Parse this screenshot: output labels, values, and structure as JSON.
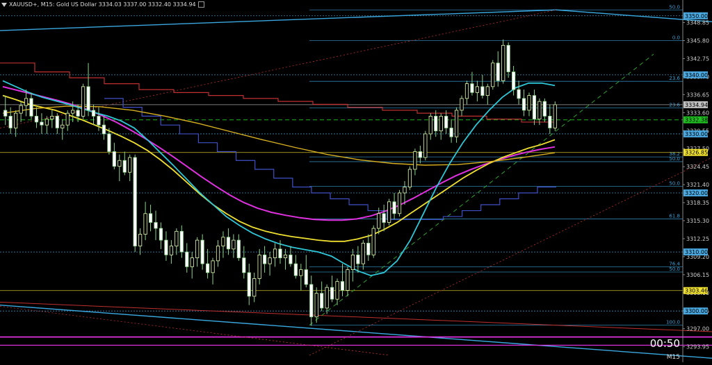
{
  "header": {
    "text": "XAUUSD+, M15: Gold US Dollar 3334.03 3337.00 3332.40 3334.94"
  },
  "footer": {
    "timer": "00:50",
    "timeframe": "M15"
  },
  "colors": {
    "background": "#000000",
    "bull": "#e8ffb0",
    "bear": "#ffffff",
    "ma_cyan": "#2ec8d8",
    "ma_yellow": "#f0e030",
    "ma_magenta": "#e030e0",
    "step_blue": "#4050c8",
    "step_red": "#c03030",
    "fib": "#3aa0d8",
    "grid": "#20406a"
  },
  "chart_data": {
    "type": "candlestick",
    "symbol": "XAUUSD+",
    "timeframe": "M15",
    "ylim": [
      3292.5,
      3351.5
    ],
    "y_ticks": [
      "3348.85",
      "3345.80",
      "3342.75",
      "3339.70",
      "3336.65",
      "3333.60",
      "3330.55",
      "3327.50",
      "3324.45",
      "3321.40",
      "3318.35",
      "3315.30",
      "3312.25",
      "3309.20",
      "3306.15",
      "3303.10",
      "3300.05",
      "3297.00",
      "3293.95"
    ],
    "price_tags": [
      {
        "value": 3350.0,
        "label": "3350.00",
        "color": "#4aa8e0"
      },
      {
        "value": 3340.0,
        "label": "3340.00",
        "color": "#4aa8e0"
      },
      {
        "value": 3334.94,
        "label": "3334.94",
        "color": "#c0c0c0"
      },
      {
        "value": 3332.38,
        "label": "3332.38",
        "color": "#20c020"
      },
      {
        "value": 3330.0,
        "label": "3330.00",
        "color": "#4aa8e0"
      },
      {
        "value": 3326.85,
        "label": "3326.85",
        "color": "#f0e030"
      },
      {
        "value": 3320.0,
        "label": "3320.00",
        "color": "#4aa8e0"
      },
      {
        "value": 3310.0,
        "label": "3310.00",
        "color": "#4aa8e0"
      },
      {
        "value": 3303.46,
        "label": "3303.46",
        "color": "#f0e030"
      },
      {
        "value": 3300.0,
        "label": "3300.00",
        "color": "#4aa8e0"
      }
    ],
    "fib_levels": [
      {
        "label": "0.0",
        "value": 3345.8
      },
      {
        "label": "23.6",
        "value": 3338.9
      },
      {
        "label": "23.6",
        "value": 3334.4
      },
      {
        "label": "38.2",
        "value": 3326.1
      },
      {
        "label": "50.0",
        "value": 3325.3
      },
      {
        "label": "50.0",
        "value": 3321.1
      },
      {
        "label": "61.8",
        "value": 3315.6
      },
      {
        "label": "76.4",
        "value": 3307.5
      },
      {
        "label": "50.0",
        "value": 3306.6
      },
      {
        "label": "100.0",
        "value": 3297.6
      },
      {
        "label": "50.0",
        "value": 3351.0
      }
    ],
    "candles": [
      [
        3334.0,
        3336.5,
        3331.5,
        3333.0
      ],
      [
        3333.0,
        3334.5,
        3330.0,
        3331.0
      ],
      [
        3331.0,
        3334.0,
        3329.5,
        3333.5
      ],
      [
        3333.5,
        3335.5,
        3332.0,
        3334.8
      ],
      [
        3334.8,
        3337.5,
        3333.0,
        3336.0
      ],
      [
        3336.0,
        3337.0,
        3332.5,
        3333.0
      ],
      [
        3333.0,
        3334.5,
        3331.0,
        3332.0
      ],
      [
        3332.0,
        3333.5,
        3330.0,
        3331.5
      ],
      [
        3331.5,
        3333.0,
        3330.0,
        3332.5
      ],
      [
        3332.5,
        3334.0,
        3331.0,
        3333.0
      ],
      [
        3333.0,
        3333.5,
        3330.0,
        3331.0
      ],
      [
        3331.0,
        3332.5,
        3329.0,
        3331.5
      ],
      [
        3331.5,
        3334.0,
        3330.5,
        3333.5
      ],
      [
        3333.5,
        3335.5,
        3332.0,
        3334.0
      ],
      [
        3334.0,
        3335.0,
        3332.0,
        3333.0
      ],
      [
        3333.0,
        3338.5,
        3332.5,
        3338.0
      ],
      [
        3338.0,
        3342.0,
        3333.0,
        3334.0
      ],
      [
        3334.0,
        3335.0,
        3331.5,
        3333.0
      ],
      [
        3333.0,
        3334.5,
        3330.5,
        3331.5
      ],
      [
        3331.5,
        3333.0,
        3329.0,
        3330.0
      ],
      [
        3330.0,
        3331.0,
        3326.5,
        3327.0
      ],
      [
        3327.0,
        3328.5,
        3324.0,
        3324.5
      ],
      [
        3324.5,
        3326.5,
        3322.0,
        3325.5
      ],
      [
        3325.5,
        3327.0,
        3323.0,
        3323.5
      ],
      [
        3323.5,
        3326.5,
        3322.0,
        3326.0
      ],
      [
        3326.0,
        3326.5,
        3310.0,
        3311.0
      ],
      [
        3311.0,
        3314.0,
        3309.5,
        3313.0
      ],
      [
        3313.0,
        3318.5,
        3312.0,
        3316.5
      ],
      [
        3316.5,
        3318.0,
        3313.5,
        3315.0
      ],
      [
        3315.0,
        3317.0,
        3312.0,
        3314.0
      ],
      [
        3314.0,
        3315.0,
        3310.5,
        3312.0
      ],
      [
        3312.0,
        3313.5,
        3308.5,
        3309.5
      ],
      [
        3309.5,
        3312.0,
        3308.0,
        3311.0
      ],
      [
        3311.0,
        3314.0,
        3309.5,
        3313.5
      ],
      [
        3313.5,
        3314.5,
        3309.0,
        3310.0
      ],
      [
        3310.0,
        3311.5,
        3306.5,
        3307.5
      ],
      [
        3307.5,
        3310.0,
        3305.5,
        3309.0
      ],
      [
        3309.0,
        3312.5,
        3307.5,
        3312.0
      ],
      [
        3312.0,
        3313.0,
        3307.0,
        3308.0
      ],
      [
        3308.0,
        3310.5,
        3305.5,
        3306.5
      ],
      [
        3306.5,
        3309.0,
        3304.5,
        3308.5
      ],
      [
        3308.5,
        3312.0,
        3307.5,
        3311.0
      ],
      [
        3311.0,
        3313.5,
        3309.0,
        3312.5
      ],
      [
        3312.5,
        3314.0,
        3309.5,
        3310.5
      ],
      [
        3310.5,
        3313.0,
        3309.0,
        3312.0
      ],
      [
        3312.0,
        3313.0,
        3308.5,
        3309.0
      ],
      [
        3309.0,
        3311.0,
        3305.5,
        3306.5
      ],
      [
        3306.5,
        3308.0,
        3301.0,
        3302.5
      ],
      [
        3302.5,
        3306.5,
        3301.5,
        3305.5
      ],
      [
        3305.5,
        3310.5,
        3304.5,
        3309.5
      ],
      [
        3309.5,
        3311.0,
        3306.5,
        3308.0
      ],
      [
        3308.0,
        3310.0,
        3306.0,
        3309.0
      ],
      [
        3309.0,
        3311.5,
        3307.5,
        3310.5
      ],
      [
        3310.5,
        3312.0,
        3308.0,
        3309.0
      ],
      [
        3309.0,
        3310.5,
        3307.0,
        3309.5
      ],
      [
        3309.5,
        3311.0,
        3307.5,
        3308.0
      ],
      [
        3308.0,
        3309.5,
        3305.5,
        3306.0
      ],
      [
        3306.0,
        3308.0,
        3303.5,
        3307.0
      ],
      [
        3307.0,
        3309.5,
        3304.0,
        3304.5
      ],
      [
        3304.5,
        3306.0,
        3297.5,
        3299.0
      ],
      [
        3299.0,
        3304.0,
        3298.0,
        3303.0
      ],
      [
        3303.0,
        3305.0,
        3300.0,
        3300.5
      ],
      [
        3300.5,
        3304.5,
        3299.5,
        3304.0
      ],
      [
        3304.0,
        3306.0,
        3301.5,
        3302.0
      ],
      [
        3302.0,
        3305.5,
        3301.0,
        3305.0
      ],
      [
        3305.0,
        3308.0,
        3302.5,
        3303.5
      ],
      [
        3303.5,
        3307.5,
        3302.5,
        3307.0
      ],
      [
        3307.0,
        3310.5,
        3305.0,
        3309.5
      ],
      [
        3309.5,
        3311.0,
        3306.5,
        3308.0
      ],
      [
        3308.0,
        3312.0,
        3307.0,
        3311.5
      ],
      [
        3311.5,
        3313.0,
        3308.5,
        3309.5
      ],
      [
        3309.5,
        3314.5,
        3309.0,
        3314.0
      ],
      [
        3314.0,
        3317.5,
        3313.0,
        3316.5
      ],
      [
        3316.5,
        3318.0,
        3313.5,
        3315.0
      ],
      [
        3315.0,
        3319.0,
        3314.5,
        3318.5
      ],
      [
        3318.5,
        3320.0,
        3315.5,
        3316.5
      ],
      [
        3316.5,
        3320.5,
        3316.0,
        3320.0
      ],
      [
        3320.0,
        3322.0,
        3318.0,
        3321.0
      ],
      [
        3321.0,
        3324.5,
        3320.5,
        3324.0
      ],
      [
        3324.0,
        3327.5,
        3323.0,
        3327.0
      ],
      [
        3327.0,
        3328.0,
        3325.0,
        3326.0
      ],
      [
        3326.0,
        3330.5,
        3325.5,
        3330.0
      ],
      [
        3330.0,
        3333.5,
        3329.0,
        3333.0
      ],
      [
        3333.0,
        3334.0,
        3329.5,
        3330.5
      ],
      [
        3330.5,
        3333.5,
        3329.0,
        3333.0
      ],
      [
        3333.0,
        3334.0,
        3330.0,
        3331.0
      ],
      [
        3331.0,
        3332.5,
        3328.5,
        3329.5
      ],
      [
        3329.5,
        3334.5,
        3328.5,
        3334.0
      ],
      [
        3334.0,
        3336.5,
        3333.0,
        3336.0
      ],
      [
        3336.0,
        3339.0,
        3335.0,
        3338.5
      ],
      [
        3338.5,
        3340.5,
        3336.5,
        3337.0
      ],
      [
        3337.0,
        3339.0,
        3335.5,
        3338.0
      ],
      [
        3338.0,
        3340.0,
        3336.0,
        3336.5
      ],
      [
        3336.5,
        3338.5,
        3335.0,
        3338.0
      ],
      [
        3338.0,
        3342.5,
        3337.5,
        3342.0
      ],
      [
        3342.0,
        3344.0,
        3338.0,
        3339.0
      ],
      [
        3339.0,
        3346.0,
        3338.5,
        3345.0
      ],
      [
        3345.0,
        3345.5,
        3339.5,
        3340.5
      ],
      [
        3340.5,
        3341.5,
        3336.5,
        3337.5
      ],
      [
        3337.5,
        3339.0,
        3335.0,
        3336.0
      ],
      [
        3336.0,
        3337.5,
        3333.0,
        3334.0
      ],
      [
        3334.0,
        3337.0,
        3333.0,
        3336.5
      ],
      [
        3336.5,
        3337.5,
        3331.5,
        3332.5
      ],
      [
        3332.5,
        3336.0,
        3331.5,
        3335.5
      ],
      [
        3335.5,
        3336.0,
        3332.0,
        3333.0
      ],
      [
        3333.0,
        3335.0,
        3330.0,
        3331.0
      ],
      [
        3331.0,
        3335.5,
        3330.5,
        3334.94
      ]
    ],
    "ma_cyan": [
      3339.0,
      3338.0,
      3337.0,
      3336.2,
      3335.6,
      3335.0,
      3334.3,
      3333.6,
      3333.0,
      3332.2,
      3331.0,
      3329.0,
      3326.8,
      3324.6,
      3322.3,
      3320.0,
      3318.0,
      3316.0,
      3314.5,
      3313.2,
      3312.2,
      3311.4,
      3310.8,
      3310.4,
      3310.0,
      3309.3,
      3308.0,
      3306.8,
      3306.0,
      3306.5,
      3308.5,
      3312.0,
      3316.5,
      3321.0,
      3325.0,
      3328.5,
      3331.5,
      3334.0,
      3336.2,
      3337.8,
      3338.6,
      3338.6,
      3338.2
    ],
    "ma_yellow": [
      3336.5,
      3335.8,
      3335.0,
      3334.5,
      3334.0,
      3333.2,
      3332.4,
      3331.5,
      3330.6,
      3329.6,
      3328.5,
      3327.2,
      3325.6,
      3323.8,
      3321.8,
      3319.8,
      3318.0,
      3316.5,
      3315.2,
      3314.2,
      3313.5,
      3313.0,
      3312.6,
      3312.3,
      3312.0,
      3311.8,
      3311.8,
      3312.2,
      3312.8,
      3313.8,
      3315.0,
      3316.5,
      3318.0,
      3319.5,
      3321.0,
      3322.5,
      3323.8,
      3325.0,
      3326.0,
      3326.8,
      3327.6,
      3328.2,
      3329.0
    ],
    "ma_magenta": [
      3338.0,
      3337.4,
      3336.8,
      3336.2,
      3335.6,
      3334.9,
      3334.1,
      3333.1,
      3332.0,
      3330.7,
      3329.3,
      3327.8,
      3326.2,
      3324.5,
      3322.8,
      3321.2,
      3319.7,
      3318.4,
      3317.4,
      3316.7,
      3316.2,
      3315.8,
      3315.5,
      3315.4,
      3315.4,
      3315.6,
      3316.1,
      3316.9,
      3317.9,
      3319.1,
      3320.4,
      3321.7,
      3322.9,
      3323.9,
      3324.8,
      3325.6,
      3326.3,
      3326.9,
      3327.4,
      3327.8
    ],
    "ma_yellow_long": [
      3333.5,
      3334.3,
      3334.7,
      3334.6,
      3334.0,
      3333.0,
      3331.8,
      3330.4,
      3329.0,
      3327.7,
      3326.5,
      3325.6,
      3325.0,
      3324.7,
      3324.8,
      3325.3,
      3326.0,
      3326.8
    ],
    "steps_blue": [
      3336.0,
      3334.5,
      3333.0,
      3331.5,
      3330.0,
      3328.5,
      3327.0,
      3325.5,
      3324.0,
      3322.5,
      3321.0,
      3320.0,
      3319.0,
      3318.0,
      3317.0,
      3315.5,
      3315.5,
      3315.5,
      3316.0,
      3317.0,
      3318.0,
      3319.0,
      3320.0,
      3321.0
    ],
    "steps_red": [
      3342.0,
      3340.5,
      3339.5,
      3338.5,
      3337.5,
      3337.0,
      3336.5,
      3336.0,
      3335.5,
      3335.0,
      3334.5,
      3334.0,
      3333.5,
      3333.0,
      3332.5,
      3332.0
    ]
  }
}
